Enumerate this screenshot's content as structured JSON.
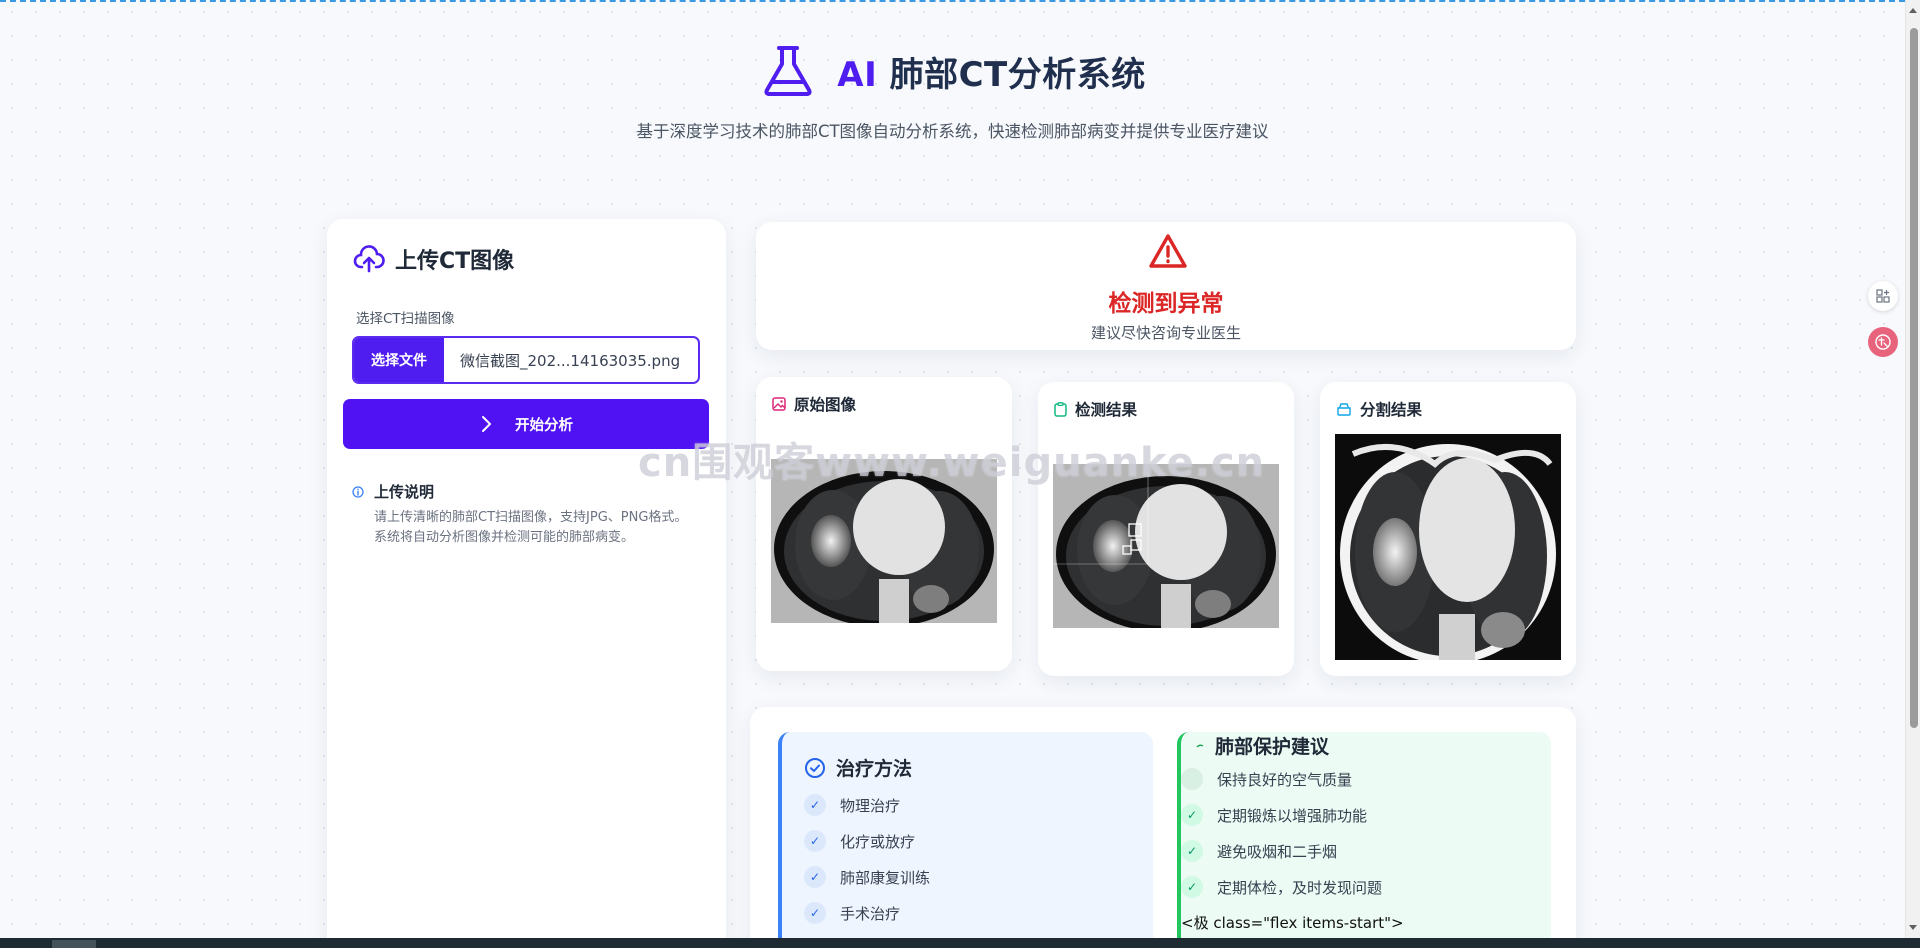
{
  "header": {
    "title_ai": "AI",
    "title_rest": " 肺部CT分析系统",
    "subtitle": "基于深度学习技术的肺部CT图像自动分析系统，快速检测肺部病变并提供专业医疗建议"
  },
  "upload": {
    "title": "上传CT图像",
    "field_label": "选择CT扫描图像",
    "choose_file_label": "选择文件",
    "file_name": "微信截图_202...14163035.png",
    "analyze_label": "开始分析",
    "note_title": "上传说明",
    "note_body": "请上传清晰的肺部CT扫描图像，支持JPG、PNG格式。系统将自动分析图像并检测可能的肺部病变。"
  },
  "alert": {
    "title": "检测到异常",
    "subtitle": "建议尽快咨询专业医生"
  },
  "images": {
    "original_title": "原始图像",
    "detection_title": "检测结果",
    "segmentation_title": "分割结果"
  },
  "watermark": "cn围观客www.weiguanke.cn",
  "treatment": {
    "title": "治疗方法",
    "items": [
      "物理治疗",
      "化疗或放疗",
      "肺部康复训练",
      "手术治疗"
    ]
  },
  "protection": {
    "title": "肺部保护建议",
    "items": [
      "保持良好的空气质量",
      "定期锻炼以增强肺功能",
      "避免吸烟和二手烟",
      "定期体检，及时发现问题"
    ],
    "raw_code": "<极 class=\"flex items-start\">"
  },
  "colors": {
    "brand": "#4f1df0",
    "alert": "#dc2626",
    "treatment_accent": "#3b82f6",
    "protection_accent": "#22c55e"
  },
  "icons": {
    "header": "flask-icon",
    "upload": "cloud-upload-icon",
    "analyze": "chevron-right-icon",
    "note": "info-icon",
    "alert": "warning-triangle-icon",
    "original": "image-icon",
    "detection": "clipboard-icon",
    "segmentation": "layers-icon",
    "treatment": "check-circle-icon",
    "protection": "leaf-icon",
    "side_1": "apps-icon",
    "side_2": "translate-icon"
  }
}
